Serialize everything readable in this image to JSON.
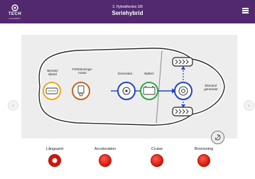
{
  "header": {
    "logo_text": "TECH",
    "logo_sub": "ACADEMY",
    "subtitle": "3. Hybridfordon 3/8",
    "title": "Seriehybrid"
  },
  "diagram": {
    "components": [
      {
        "label": "Bensin/\ndiesel",
        "color": "#f2a516",
        "icon": "fuel-tank-icon"
      },
      {
        "label": "Förbrännings-\nmotor",
        "color": "#c8651e",
        "icon": "engine-icon"
      },
      {
        "label": "Generator",
        "color": "#2443c4",
        "icon": "generator-icon"
      },
      {
        "label": "Batteri",
        "color": "#28a83a",
        "icon": "battery-icon"
      },
      {
        "label": "Elmotor/\ngenerator",
        "color": "#2443c4",
        "icon": "electric-motor-icon"
      }
    ],
    "wheel_count": 4
  },
  "controls": [
    {
      "label": "Långsamt",
      "active": true
    },
    {
      "label": "Acceleration",
      "active": false
    },
    {
      "label": "Cruise",
      "active": false
    },
    {
      "label": "Bromsning",
      "active": false
    }
  ]
}
